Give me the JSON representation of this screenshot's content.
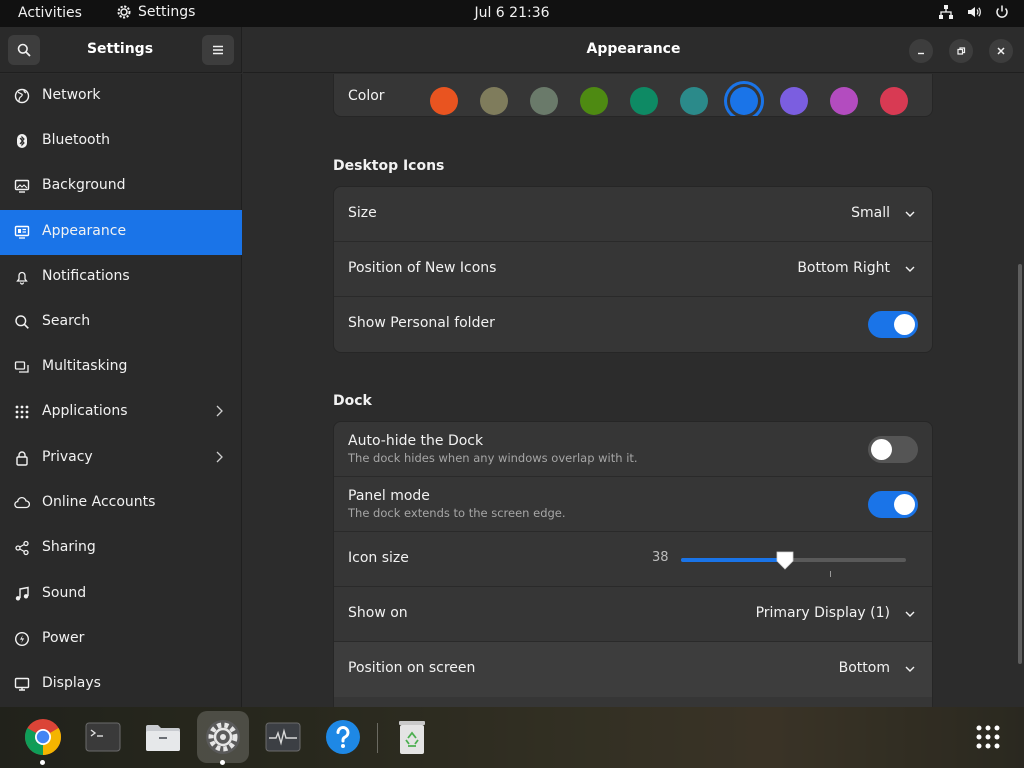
{
  "topbar": {
    "activities": "Activities",
    "app_name": "Settings",
    "clock": "Jul 6  21:36",
    "status_icons": [
      "network-icon",
      "volume-icon",
      "power-icon"
    ]
  },
  "window": {
    "sidebar_title": "Settings",
    "title": "Appearance"
  },
  "sidebar": {
    "items": [
      {
        "label": "Network",
        "icon": "globe-icon"
      },
      {
        "label": "Bluetooth",
        "icon": "bluetooth-icon"
      },
      {
        "label": "Background",
        "icon": "monitor-icon"
      },
      {
        "label": "Appearance",
        "icon": "appearance-icon",
        "selected": true
      },
      {
        "label": "Notifications",
        "icon": "bell-icon"
      },
      {
        "label": "Search",
        "icon": "search-icon"
      },
      {
        "label": "Multitasking",
        "icon": "multitasking-icon"
      },
      {
        "label": "Applications",
        "icon": "apps-grid-icon",
        "has_submenu": true
      },
      {
        "label": "Privacy",
        "icon": "lock-icon",
        "has_submenu": true
      },
      {
        "label": "Online Accounts",
        "icon": "cloud-icon"
      },
      {
        "label": "Sharing",
        "icon": "share-icon"
      },
      {
        "label": "Sound",
        "icon": "music-note-icon"
      },
      {
        "label": "Power",
        "icon": "power-icon"
      },
      {
        "label": "Displays",
        "icon": "display-icon"
      }
    ]
  },
  "appearance": {
    "color": {
      "label": "Color",
      "swatches": [
        "#e95420",
        "#7f7c5c",
        "#6a7a6a",
        "#4e8a12",
        "#0e8a64",
        "#2b8a8a",
        "#1a74e8",
        "#7b5ee0",
        "#b34cbf",
        "#d83a53"
      ],
      "selected_index": 6
    },
    "desktop_icons": {
      "title": "Desktop Icons",
      "size": {
        "label": "Size",
        "value": "Small"
      },
      "position": {
        "label": "Position of New Icons",
        "value": "Bottom Right"
      },
      "personal_folder": {
        "label": "Show Personal folder",
        "on": true
      }
    },
    "dock": {
      "title": "Dock",
      "autohide": {
        "title": "Auto-hide the Dock",
        "subtitle": "The dock hides when any windows overlap with it.",
        "on": false
      },
      "panel_mode": {
        "title": "Panel mode",
        "subtitle": "The dock extends to the screen edge.",
        "on": true
      },
      "icon_size": {
        "label": "Icon size",
        "value": "38",
        "fraction": 0.46
      },
      "show_on": {
        "label": "Show on",
        "value": "Primary Display (1)"
      },
      "position": {
        "label": "Position on screen",
        "value": "Bottom"
      }
    }
  },
  "dock_bar": {
    "apps": [
      "chrome-icon",
      "terminal-icon",
      "files-icon",
      "settings-icon",
      "system-monitor-icon",
      "help-icon",
      "trash-icon"
    ],
    "show_apps": "apps-grid-icon",
    "accent": "#1a74e8"
  }
}
